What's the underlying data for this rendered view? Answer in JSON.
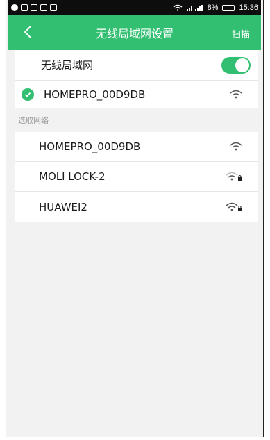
{
  "status_bar": {
    "time": "15:36",
    "battery": "8%"
  },
  "header": {
    "title": "无线局域网设置",
    "scan_label": "扫描"
  },
  "wlan_toggle": {
    "label": "无线局域网",
    "on": true
  },
  "connected": {
    "ssid": "HOMEPRO_00D9DB",
    "icon": "wifi-icon"
  },
  "section_label": "选取网络",
  "networks": [
    {
      "ssid": "HOMEPRO_00D9DB",
      "locked": false
    },
    {
      "ssid": "MOLI LOCK-2",
      "locked": true
    },
    {
      "ssid": "HUAWEI2",
      "locked": true
    }
  ],
  "colors": {
    "accent": "#33bf72",
    "background": "#f2f2f2"
  }
}
